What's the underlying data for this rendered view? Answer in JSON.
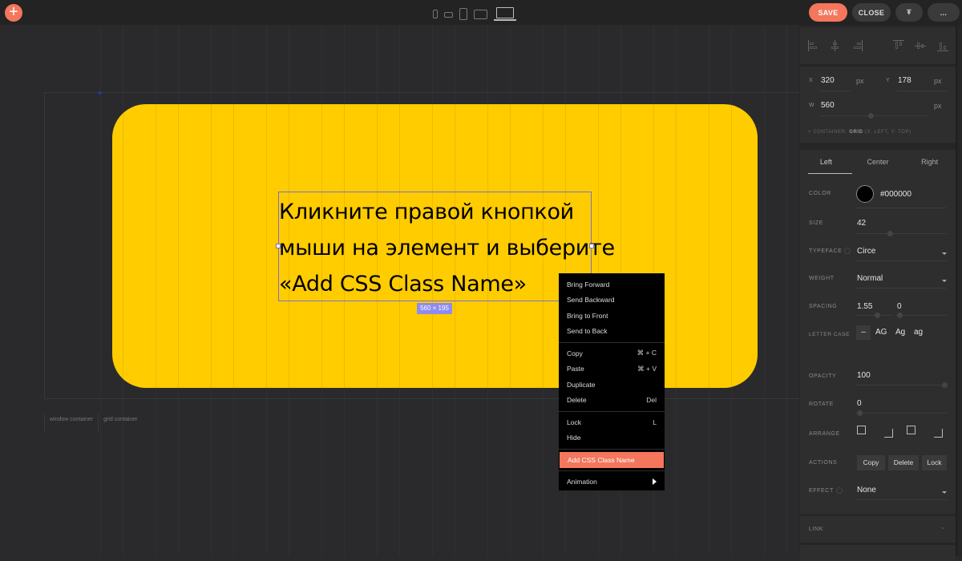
{
  "topbar": {
    "add_icon": "plus-icon",
    "devices": [
      "phone-portrait-icon",
      "phone-landscape-icon",
      "tablet-portrait-icon",
      "tablet-landscape-icon",
      "laptop-icon"
    ],
    "save_label": "SAVE",
    "close_label": "CLOSE",
    "pin_icon": "pin-icon",
    "more_label": "..."
  },
  "canvas": {
    "text_lines": [
      "Кликните правой кнопкой",
      "мыши на элемент и выберите",
      "«Add CSS Class Name»"
    ],
    "size_badge": "560 × 195",
    "container_labels": [
      "window container",
      "grid container"
    ],
    "colors": {
      "block": "#ffcc00",
      "selection": "#7a6fd0",
      "badge": "#8e8cf0"
    }
  },
  "context_menu": {
    "groups": [
      [
        {
          "label": "Bring Forward",
          "shortcut": ""
        },
        {
          "label": "Send Backward",
          "shortcut": ""
        },
        {
          "label": "Bring to Front",
          "shortcut": ""
        },
        {
          "label": "Send to Back",
          "shortcut": ""
        }
      ],
      [
        {
          "label": "Copy",
          "shortcut": "⌘ + C"
        },
        {
          "label": "Paste",
          "shortcut": "⌘ + V"
        },
        {
          "label": "Duplicate",
          "shortcut": ""
        },
        {
          "label": "Delete",
          "shortcut": "Del"
        }
      ],
      [
        {
          "label": "Lock",
          "shortcut": "L"
        },
        {
          "label": "Hide",
          "shortcut": ""
        }
      ],
      [
        {
          "label": "Add CSS Class Name",
          "shortcut": "",
          "active": true
        }
      ],
      [
        {
          "label": "Animation",
          "shortcut": "",
          "submenu": true
        }
      ]
    ],
    "active_color": "#f4765c"
  },
  "panel": {
    "position": {
      "x_label": "X",
      "x_value": "320",
      "x_unit": "px",
      "y_label": "Y",
      "y_value": "178",
      "y_unit": "px",
      "w_label": "W",
      "w_value": "560",
      "w_unit": "px",
      "container_note_prefix": "+ CONTAINER: ",
      "container_note_grid": "GRID",
      "container_note_rest": " (X: LEFT, Y: TOP)"
    },
    "typography": {
      "tabs": [
        "Left",
        "Center",
        "Right"
      ],
      "active_tab": "Left",
      "color_label": "COLOR",
      "color_value": "#000000",
      "size_label": "SIZE",
      "size_value": "42",
      "typeface_label": "TYPEFACE",
      "typeface_value": "Circe",
      "weight_label": "WEIGHT",
      "weight_value": "Normal",
      "spacing_label": "SPACING",
      "line_spacing": "1.55",
      "letter_spacing": "0",
      "letter_case_label": "LETTER CASE",
      "letter_case_options": [
        "–",
        "AG",
        "Ag",
        "ag"
      ]
    },
    "transform": {
      "opacity_label": "OPACITY",
      "opacity_value": "100",
      "rotate_label": "ROTATE",
      "rotate_value": "0",
      "arrange_label": "ARRANGE",
      "actions_label": "ACTIONS",
      "actions": [
        "Copy",
        "Delete",
        "Lock"
      ],
      "effect_label": "EFFECT",
      "effect_value": "None"
    },
    "link_label": "LINK"
  }
}
